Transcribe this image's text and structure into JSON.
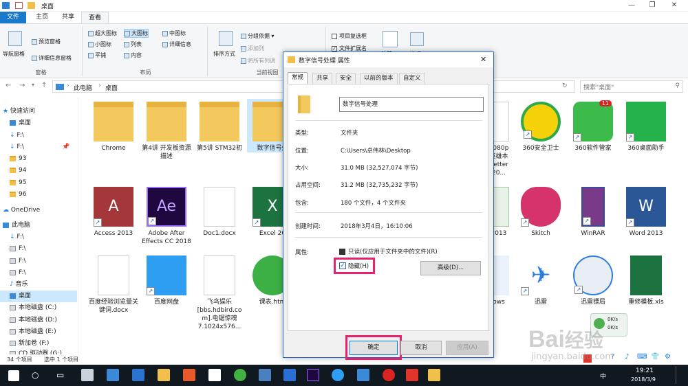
{
  "window": {
    "title": "桌面"
  },
  "ribbon": {
    "tabs": [
      "文件",
      "主页",
      "共享",
      "查看"
    ],
    "panes_group": {
      "nav_pane": "导航窗格",
      "preview_pane": "预览窗格",
      "details_pane": "详细信息窗格",
      "label": "窗格"
    },
    "layout_group": {
      "items": [
        "超大图标",
        "大图标",
        "中图标",
        "小图标",
        "列表",
        "详细信息",
        "平铺",
        "内容"
      ],
      "label": "布局"
    },
    "current_view_group": {
      "sort": "排序方式",
      "group_by": "分组依据",
      "add_column": "添加列",
      "fit_columns": "将所有列调",
      "label": "当前视图"
    },
    "show_group": {
      "item_checkbox": "项目复选框",
      "file_ext": "文件扩展名",
      "hidden": "隐藏",
      "options": "选项"
    }
  },
  "address": {
    "crumbs": [
      "此电脑",
      "桌面"
    ],
    "search_placeholder": "搜索\"桌面\""
  },
  "nav": {
    "items": [
      {
        "label": "快速访问",
        "type": "star"
      },
      {
        "label": "桌面",
        "type": "pc"
      },
      {
        "label": "F:\\",
        "type": "dl"
      },
      {
        "label": "F:\\",
        "type": "dl"
      },
      {
        "label": "93",
        "type": "folder"
      },
      {
        "label": "94",
        "type": "folder"
      },
      {
        "label": "95",
        "type": "folder"
      },
      {
        "label": "96",
        "type": "folder"
      },
      {
        "label": "OneDrive",
        "type": "cloud"
      },
      {
        "label": "此电脑",
        "type": "pc"
      },
      {
        "label": "F:\\",
        "type": "dl"
      },
      {
        "label": "F:\\",
        "type": "drive"
      },
      {
        "label": "F:\\",
        "type": "drive"
      },
      {
        "label": "F:\\",
        "type": "drive"
      },
      {
        "label": "音乐",
        "type": "music"
      },
      {
        "label": "桌面",
        "type": "pc"
      },
      {
        "label": "本地磁盘 (C:)",
        "type": "drive"
      },
      {
        "label": "本地磁盘 (D:)",
        "type": "drive"
      },
      {
        "label": "本地磁盘 (E:)",
        "type": "drive"
      },
      {
        "label": "新加卷 (F:)",
        "type": "drive"
      },
      {
        "label": "CD 驱动器 (G:)",
        "type": "drive"
      }
    ]
  },
  "files": {
    "row1": [
      "Chrome",
      "第4讲 开发板资源描述",
      "第5讲 STM32初",
      "数字信号处",
      "1080p 英雄本 Better 20...",
      "360安全卫士",
      "360软件管家",
      "360桌面助手"
    ],
    "row2": [
      "Access 2013",
      "Adobe After Effects CC 2018",
      "Doc1.docx",
      "Excel 20",
      "2013",
      "Skitch",
      "WinRAR",
      "Word 2013"
    ],
    "row3": [
      "百度经验浏览量关键词.docx",
      "百度网盘",
      "飞鸟娱乐 [bbs.hdbird.co m].电锯惊魂 7.1024x576...",
      "课表.htm",
      "ows",
      "迅雷",
      "迅雷镖局",
      "重修模板.xls"
    ]
  },
  "status": {
    "count": "34 个项目",
    "selected": "选中 1 个项目"
  },
  "dialog": {
    "title": "数字信号处理 属性",
    "tabs": [
      "常规",
      "共享",
      "安全",
      "以前的版本",
      "自定义"
    ],
    "name_value": "数字信号处理",
    "rows": [
      {
        "label": "类型:",
        "value": "文件夹"
      },
      {
        "label": "位置:",
        "value": "C:\\Users\\卓伟林\\Desktop"
      },
      {
        "label": "大小:",
        "value": "31.0 MB (32,527,074 字节)"
      },
      {
        "label": "占用空间:",
        "value": "31.2 MB (32,735,232 字节)"
      },
      {
        "label": "包含:",
        "value": "180 个文件，4 个文件夹"
      },
      {
        "label": "创建时间:",
        "value": "2018年3月4日，16:10:06"
      }
    ],
    "attr_label": "属性:",
    "readonly_label": "只读(仅应用于文件夹中的文件)(R)",
    "hidden_label": "隐藏(H)",
    "advanced_label": "高级(D)...",
    "ok": "确定",
    "cancel": "取消",
    "apply": "应用(A)"
  },
  "taskbar": {
    "time": "19:21",
    "date": "2018/3/9",
    "ime": "中",
    "net_up": "0K/s",
    "net_down": "0K/s"
  },
  "watermark": {
    "brand": "Bai",
    "suffix": "经验",
    "url": "jingyan.baidu.com"
  },
  "colors": {
    "accent": "#1979ca",
    "highlight": "#e5226f",
    "taskbar": "#101820"
  }
}
